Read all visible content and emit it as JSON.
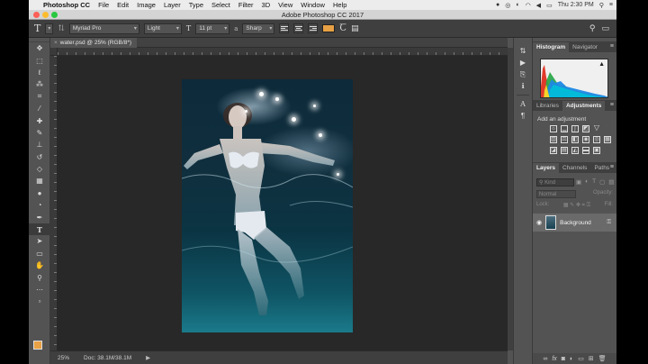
{
  "menubar": {
    "app_name": "Photoshop CC",
    "items": [
      "File",
      "Edit",
      "Image",
      "Layer",
      "Type",
      "Select",
      "Filter",
      "3D",
      "View",
      "Window",
      "Help"
    ],
    "clock": "Thu 2:30 PM"
  },
  "window": {
    "title": "Adobe Photoshop CC 2017"
  },
  "options_bar": {
    "font_family": "Myriad Pro",
    "font_style": "Light",
    "font_size": "11 pt",
    "antialias": "Sharp",
    "text_color": "#e8a144"
  },
  "document": {
    "tab_label": "water.psd @ 25% (RGB/8*)",
    "zoom": "25%",
    "doc_size": "Doc: 38.1M/38.1M"
  },
  "histogram_panel": {
    "tabs": [
      "Histogram",
      "Navigator"
    ],
    "active": "Histogram"
  },
  "adjustments_panel": {
    "tabs": [
      "Libraries",
      "Adjustments"
    ],
    "active": "Adjustments",
    "heading": "Add an adjustment"
  },
  "layers_panel": {
    "tabs": [
      "Layers",
      "Channels",
      "Paths"
    ],
    "active": "Layers",
    "search_placeholder": "Kind",
    "blend_mode": "Normal",
    "opacity_label": "Opacity:",
    "lock_label": "Lock:",
    "fill_label": "Fill:",
    "layers": [
      {
        "name": "Background",
        "locked": true,
        "visible": true
      }
    ]
  }
}
